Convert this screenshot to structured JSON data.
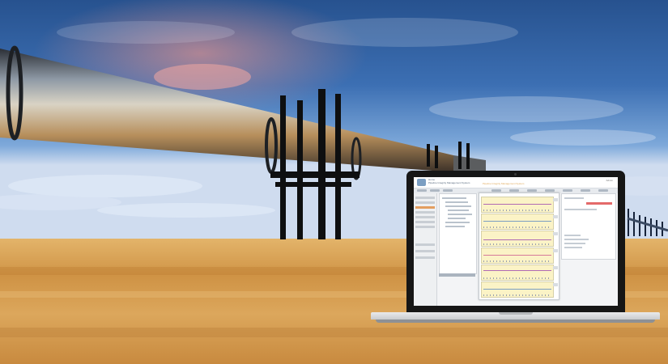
{
  "scene": {
    "description_colors": {
      "sky_top": "#2d5a9b",
      "sky_mid": "#5b8fd0",
      "horizon": "#c8d8ee",
      "desert": "#d9a357",
      "pipe": "#8c857c",
      "laptop_bezel": "#161616",
      "accent_orange": "#e39e60"
    }
  },
  "laptop_screen": {
    "app_title_line1": "Home",
    "app_title_line2": "Pipeline Integrity Management System",
    "main_title": "Pipeline Integrity Management System",
    "header_right": "Admin"
  }
}
